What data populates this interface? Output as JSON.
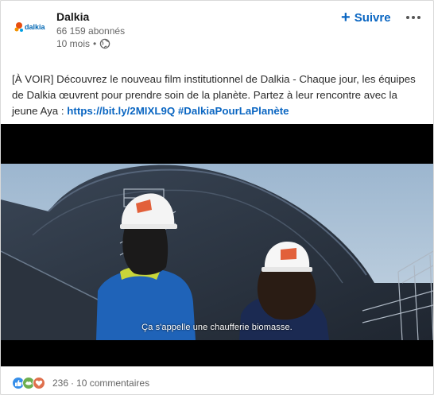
{
  "post": {
    "author_name": "Dalkia",
    "followers": "66 159 abonnés",
    "age": "10 mois",
    "separator": "•",
    "follow_label": "Suivre",
    "follow_plus": "+",
    "text": "[À VOIR] Découvrez le nouveau film institutionnel de Dalkia - Chaque jour, les équipes de Dalkia œuvrent pour prendre soin de la planète. Partez à leur rencontre avec la jeune Aya : ",
    "link": "https://bit.ly/2MIXL9Q",
    "hashtag": "#DalkiaPourLaPlanète",
    "logo_text": "dalkia"
  },
  "video": {
    "subtitle": "Ça s'appelle une chaufferie biomasse."
  },
  "social": {
    "reaction_count": "236",
    "dot": "·",
    "comments": "10 commentaires"
  },
  "icons": {
    "globe": "globe-icon",
    "more": "more-icon",
    "like": "like-icon",
    "support": "support-icon",
    "love": "love-icon"
  },
  "colors": {
    "accent": "#0a66c2",
    "like": "#378fe9",
    "support": "#6dae4f",
    "love": "#df704d"
  }
}
